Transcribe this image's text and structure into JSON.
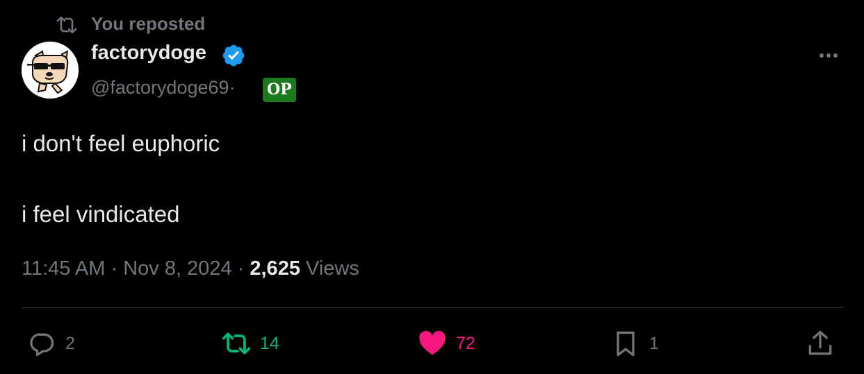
{
  "repost": {
    "label": "You reposted",
    "icon": "repost-icon"
  },
  "author": {
    "display_name": "factorydoge",
    "handle": "@factorydoge69",
    "separator": "·",
    "badge": "OP",
    "verified": true
  },
  "tweet": {
    "lines": [
      "i don't feel euphoric",
      "i feel vindicated"
    ]
  },
  "meta": {
    "time": "11:45 AM",
    "date": "Nov 8, 2024",
    "views_count": "2,625",
    "views_label": "Views"
  },
  "actions": {
    "reply_count": "2",
    "retweet_count": "14",
    "like_count": "72",
    "bookmark_count": "1"
  },
  "colors": {
    "background": "#000000",
    "text": "#e7e9ea",
    "muted": "#71767b",
    "retweet": "#00ba7c",
    "like": "#f91880",
    "verified": "#1d9bf0",
    "op_badge": "#1b7a1b"
  }
}
